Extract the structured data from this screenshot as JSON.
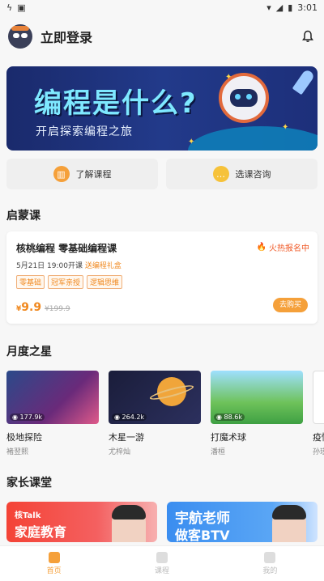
{
  "status_bar": {
    "time": "3:01",
    "icons": [
      "notification-icon",
      "sim-icon",
      "wifi-icon",
      "signal-icon",
      "battery-icon"
    ]
  },
  "header": {
    "login_label": "立即登录"
  },
  "banner": {
    "title": "编程是什么?",
    "subtitle": "开启探索编程之旅"
  },
  "quick_actions": [
    {
      "label": "了解课程",
      "icon": "book-icon"
    },
    {
      "label": "选课咨询",
      "icon": "chat-icon"
    }
  ],
  "enlightenment": {
    "section_title": "启蒙课",
    "course": {
      "name": "核桃编程  零基础编程课",
      "hot_label": "火热报名中",
      "date_text": "5月21日 19:00开课",
      "gift_text": "送编程礼盒",
      "tags": [
        "零基础",
        "冠军亲授",
        "逻辑思维"
      ],
      "currency": "¥",
      "price": "9.9",
      "original_price": "¥199.9",
      "buy_label": "去购买"
    }
  },
  "monthly_stars": {
    "section_title": "月度之星",
    "items": [
      {
        "title": "极地探险",
        "author": "褚翌熙",
        "views": "177.9k"
      },
      {
        "title": "木星一游",
        "author": "尤梓灿",
        "views": "264.2k"
      },
      {
        "title": "打魔术球",
        "author": "潘桓",
        "views": "88.6k"
      },
      {
        "title": "疫情",
        "author": "孙瑾",
        "views": ""
      }
    ]
  },
  "parent_class": {
    "section_title": "家长课堂",
    "cards": [
      {
        "logo": "核Talk",
        "title": "家庭教育"
      },
      {
        "title": "宇航老师",
        "title2": "做客BTV"
      }
    ]
  },
  "tabbar": [
    {
      "label": "首页",
      "active": true
    },
    {
      "label": "课程",
      "active": false
    },
    {
      "label": "我的",
      "active": false
    }
  ],
  "colors": {
    "accent": "#f5a03a",
    "hot": "#f05a28"
  }
}
